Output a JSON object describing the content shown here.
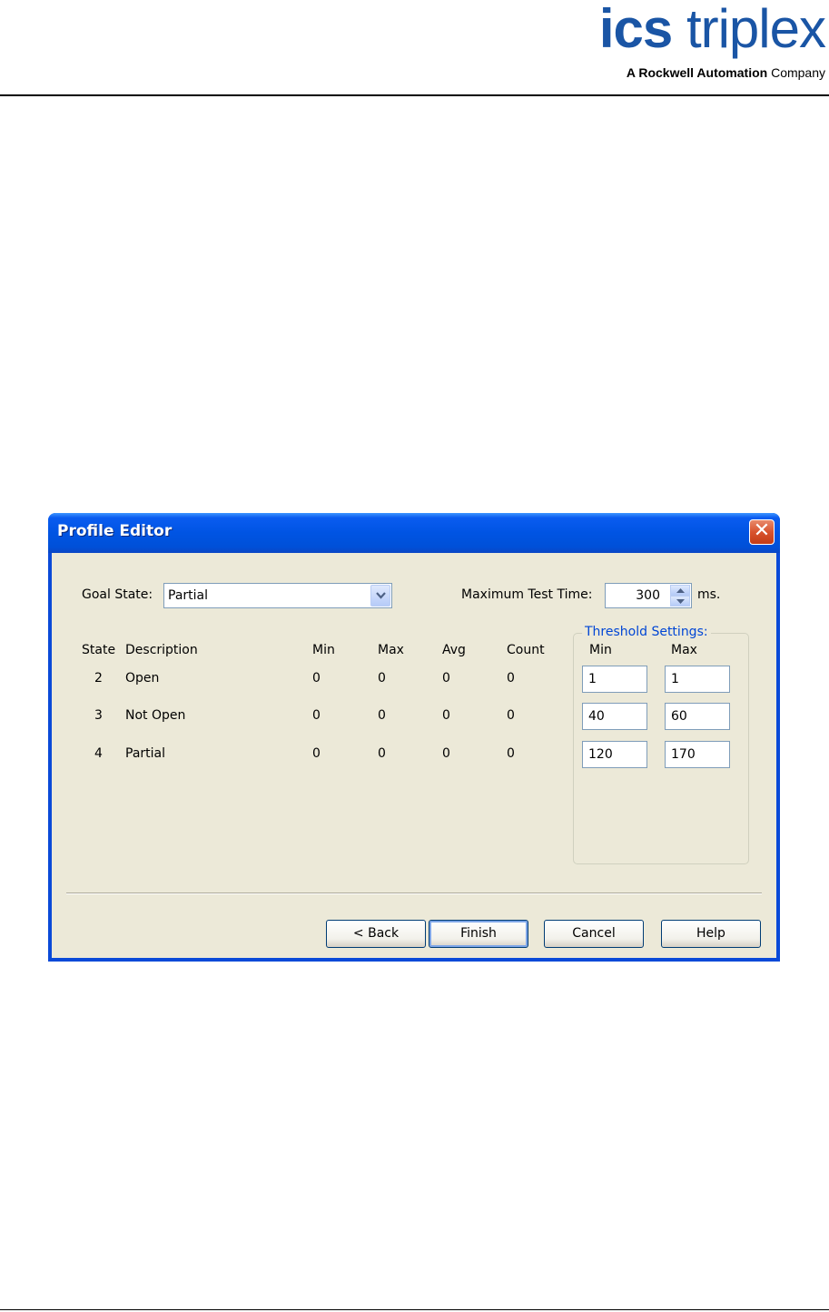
{
  "header": {
    "logo_ics": "ics",
    "logo_triplex": "triplex",
    "logo_tagline_bold": "A Rockwell Automation",
    "logo_tagline_rest": "Company"
  },
  "dialog": {
    "title": "Profile Editor",
    "close_glyph": "✕",
    "goal_state_label": "Goal State:",
    "goal_state_value": "Partial",
    "max_test_time_label": "Maximum Test Time:",
    "max_test_time_value": "300",
    "max_test_time_unit": "ms.",
    "threshold_title": "Threshold Settings:",
    "columns": {
      "state": "State",
      "description": "Description",
      "min": "Min",
      "max": "Max",
      "avg": "Avg",
      "count": "Count",
      "threshold_min": "Min",
      "threshold_max": "Max"
    },
    "rows": [
      {
        "state": "2",
        "description": "Open",
        "min": "0",
        "max": "0",
        "avg": "0",
        "count": "0",
        "thr_min": "1",
        "thr_max": "1"
      },
      {
        "state": "3",
        "description": "Not Open",
        "min": "0",
        "max": "0",
        "avg": "0",
        "count": "0",
        "thr_min": "40",
        "thr_max": "60"
      },
      {
        "state": "4",
        "description": "Partial",
        "min": "0",
        "max": "0",
        "avg": "0",
        "count": "0",
        "thr_min": "120",
        "thr_max": "170"
      }
    ],
    "buttons": {
      "back": "< Back",
      "finish": "Finish",
      "cancel": "Cancel",
      "help": "Help"
    }
  },
  "colors": {
    "title_bar": "#0054e3",
    "dialog_face": "#ece9d8",
    "group_title": "#0046d5",
    "logo_blue": "#1a55a5"
  }
}
